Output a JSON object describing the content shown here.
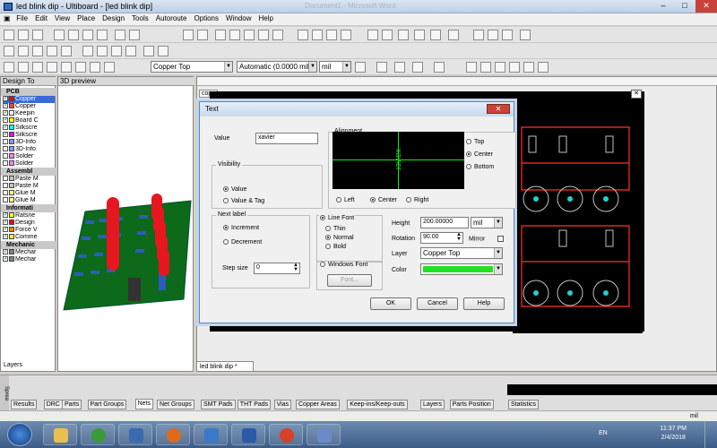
{
  "window": {
    "title": "led blink dip - Ultiboard - [led blink dip]",
    "ghost_title": "Document1 - Microsoft Word"
  },
  "menu": [
    "File",
    "Edit",
    "View",
    "Place",
    "Design",
    "Tools",
    "Autoroute",
    "Options",
    "Window",
    "Help"
  ],
  "toolbar": {
    "layer_select": "Copper Top",
    "grid_select": "Automatic (0.0000 mil",
    "unit_select": "mil"
  },
  "left_panel": {
    "title": "Design To",
    "groups": [
      {
        "name": "PCB",
        "items": [
          {
            "label": "Copper",
            "color": "#ff0000",
            "checked": true,
            "highlight": true
          },
          {
            "label": "Copper",
            "color": "#ff4040",
            "checked": true
          },
          {
            "label": "Keepin",
            "color": "#ffffff",
            "checked": true
          },
          {
            "label": "Board C",
            "color": "#ffff00",
            "checked": true
          },
          {
            "label": "Silkscre",
            "color": "#00ffff",
            "checked": true
          },
          {
            "label": "Silkscre",
            "color": "#ff00ff",
            "checked": true
          },
          {
            "label": "3D-Info",
            "color": "#9090ff",
            "checked": false
          },
          {
            "label": "3D-Info",
            "color": "#9090ff",
            "checked": false
          },
          {
            "label": "Solder",
            "color": "#ff80ff",
            "checked": false
          },
          {
            "label": "Solder",
            "color": "#ff80ff",
            "checked": false
          }
        ]
      },
      {
        "name": "Assembl",
        "items": [
          {
            "label": "Paste M",
            "color": "#c0c0c0",
            "checked": false
          },
          {
            "label": "Paste M",
            "color": "#c0c0c0",
            "checked": false
          },
          {
            "label": "Glue M",
            "color": "#ffff80",
            "checked": false
          },
          {
            "label": "Glue M",
            "color": "#ffff80",
            "checked": false
          }
        ]
      },
      {
        "name": "Informati",
        "items": [
          {
            "label": "Ratsne",
            "color": "#ffff00",
            "checked": true
          },
          {
            "label": "Design",
            "color": "#ff0000",
            "checked": true
          },
          {
            "label": "Force V",
            "color": "#ff8000",
            "checked": true
          },
          {
            "label": "Comme",
            "color": "#ffff00",
            "checked": true
          }
        ]
      },
      {
        "name": "Mechanic",
        "items": [
          {
            "label": "Mechar",
            "color": "#808080",
            "checked": true
          },
          {
            "label": "Mechar",
            "color": "#808080",
            "checked": true
          }
        ]
      }
    ],
    "tab": "Layers"
  },
  "preview": {
    "title": "3D preview"
  },
  "workspace": {
    "copy_label": "copy",
    "doc_tab": "led blink dip *"
  },
  "dialog": {
    "title": "Text",
    "close": "✕",
    "value_label": "Value",
    "value": "xavier",
    "visibility": {
      "legend": "Visibility",
      "options": [
        "Value",
        "Value & Tag"
      ],
      "selected": 0
    },
    "alignment": {
      "legend": "Alignment",
      "vertical": [
        "Top",
        "Center",
        "Bottom"
      ],
      "vertical_selected": 1,
      "horizontal": [
        "Left",
        "Center",
        "Right"
      ],
      "horizontal_selected": 1,
      "preview_text": "xavier"
    },
    "next_label": {
      "legend": "Next label",
      "options": [
        "Increment",
        "Decrement"
      ],
      "selected": 0,
      "step_label": "Step size",
      "step_value": "0"
    },
    "line_font": {
      "label": "Line Font",
      "options": [
        "Thin",
        "Normal",
        "Bold"
      ],
      "selected": 1
    },
    "windows_font": {
      "label": "Windows Font",
      "font_button": "Font..."
    },
    "height_label": "Height",
    "height": "200.00000",
    "height_unit": "mil",
    "rotation_label": "Rotation",
    "rotation": "90.00",
    "mirror_label": "Mirror",
    "layer_label": "Layer",
    "layer": "Copper Top",
    "color_label": "Color",
    "color": "#22e022",
    "buttons": {
      "ok": "OK",
      "cancel": "Cancel",
      "help": "Help"
    }
  },
  "bottom_tabs": [
    "Results",
    "DRC",
    "Parts",
    "Part Groups",
    "Nets",
    "Net Groups",
    "SMT Pads",
    "THT Pads",
    "Vias",
    "Copper Areas",
    "Keep-ins/Keep-outs",
    "Layers",
    "Parts Position",
    "Statistics"
  ],
  "bottom_tab_selected": "Nets",
  "spreadsheet_label": "Sprea",
  "status": {
    "unit": "mil"
  },
  "taskbar": {
    "lang": "EN",
    "time": "11:37 PM",
    "date": "2/4/2018"
  }
}
